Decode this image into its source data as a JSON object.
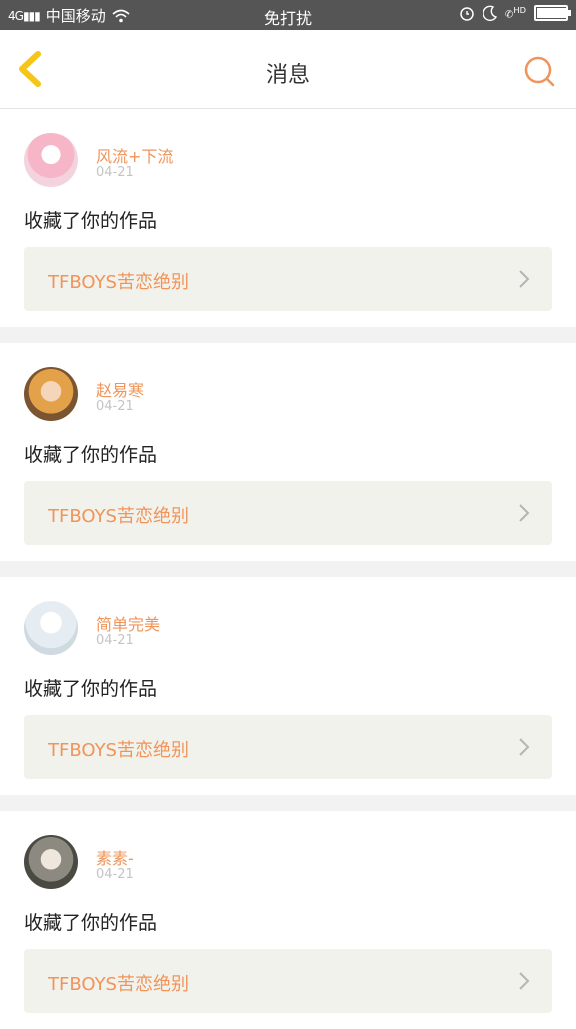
{
  "status_bar": {
    "network": "4G",
    "carrier": "中国移动",
    "mode": "免打扰",
    "hd": "HD",
    "battery_level": 0.95
  },
  "nav": {
    "title": "消息",
    "back_icon": "chevron-left-icon",
    "search_icon": "search-icon",
    "accent": "#f0945a",
    "back_color": "#f5c518"
  },
  "messages": [
    {
      "user": "风流+下流",
      "date": "04-21",
      "action": "收藏了你的作品",
      "work": "TFBOYS苦恋绝别"
    },
    {
      "user": "赵易寒",
      "date": "04-21",
      "action": "收藏了你的作品",
      "work": "TFBOYS苦恋绝别"
    },
    {
      "user": "简单完美",
      "date": "04-21",
      "action": "收藏了你的作品",
      "work": "TFBOYS苦恋绝别"
    },
    {
      "user": "素素-",
      "date": "04-21",
      "action": "收藏了你的作品",
      "work": "TFBOYS苦恋绝别"
    }
  ]
}
